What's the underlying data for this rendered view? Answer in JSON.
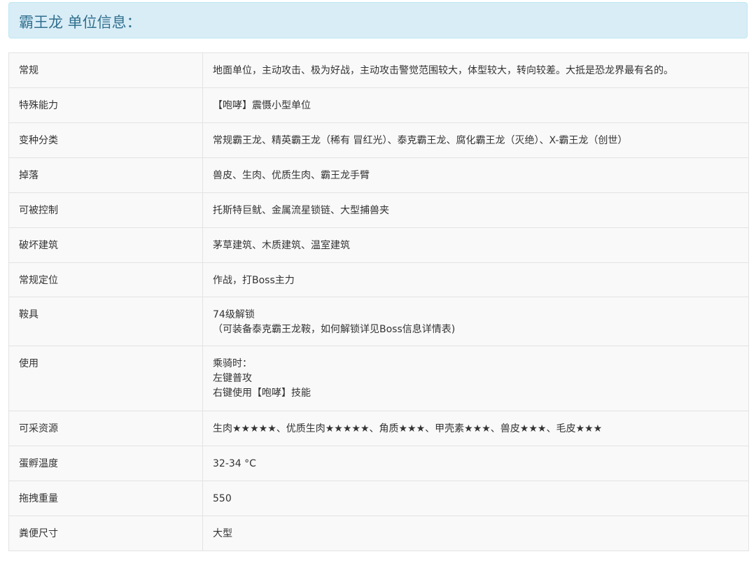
{
  "title": "霸王龙 单位信息：",
  "rows": [
    {
      "key": "常规",
      "value": [
        "地面单位，主动攻击、极为好战，主动攻击警觉范围较大，体型较大，转向较差。大抵是恐龙界最有名的。"
      ]
    },
    {
      "key": "特殊能力",
      "value": [
        "【咆哮】震慑小型单位"
      ]
    },
    {
      "key": "变种分类",
      "value": [
        "常规霸王龙、精英霸王龙（稀有 冒红光）、泰克霸王龙、腐化霸王龙（灭绝）、X-霸王龙（创世）"
      ]
    },
    {
      "key": "掉落",
      "value": [
        "兽皮、生肉、优质生肉、霸王龙手臂"
      ]
    },
    {
      "key": "可被控制",
      "value": [
        "托斯特巨鱿、金属流星锁链、大型捕兽夹"
      ]
    },
    {
      "key": "破坏建筑",
      "value": [
        "茅草建筑、木质建筑、温室建筑"
      ]
    },
    {
      "key": "常规定位",
      "value": [
        "作战，打Boss主力"
      ]
    },
    {
      "key": "鞍具",
      "value": [
        "74级解锁",
        "（可装备泰克霸王龙鞍，如何解锁详见Boss信息详情表)"
      ]
    },
    {
      "key": "使用",
      "value": [
        "乘骑时：",
        "左键普攻",
        "右键使用【咆哮】技能"
      ]
    },
    {
      "key": "可采资源",
      "value": [
        "生肉★★★★★、优质生肉★★★★★、角质★★★、甲壳素★★★、兽皮★★★、毛皮★★★"
      ]
    },
    {
      "key": "蛋孵温度",
      "value": [
        "32-34 °C"
      ]
    },
    {
      "key": "拖拽重量",
      "value": [
        "550"
      ]
    },
    {
      "key": "粪便尺寸",
      "value": [
        "大型"
      ]
    }
  ]
}
